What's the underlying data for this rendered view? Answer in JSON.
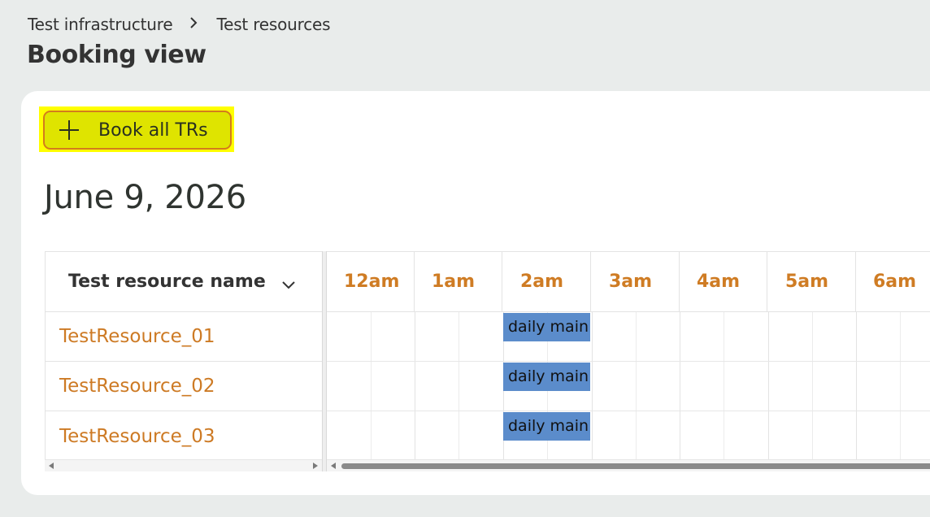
{
  "breadcrumb": {
    "items": [
      "Test infrastructure",
      "Test resources"
    ],
    "separator": ">"
  },
  "page": {
    "title": "Booking view"
  },
  "toolbar": {
    "book_all_label": "Book all TRs"
  },
  "schedule": {
    "date": "June 9, 2026",
    "name_column_header": "Test resource name",
    "hours": [
      "12am",
      "1am",
      "2am",
      "3am",
      "4am",
      "5am",
      "6am"
    ],
    "resources": [
      {
        "name": "TestResource_01",
        "event": "daily main"
      },
      {
        "name": "TestResource_02",
        "event": "daily main"
      },
      {
        "name": "TestResource_03",
        "event": "daily main"
      }
    ]
  },
  "colors": {
    "accent": "#cd7a24",
    "button_bg": "#dfe400",
    "highlight": "#ffff00",
    "event_bg": "#5b8ccb"
  },
  "icons": {
    "add": "plus-icon",
    "sort": "chevron-down-icon",
    "crumb_sep": "chevron-right-icon"
  }
}
